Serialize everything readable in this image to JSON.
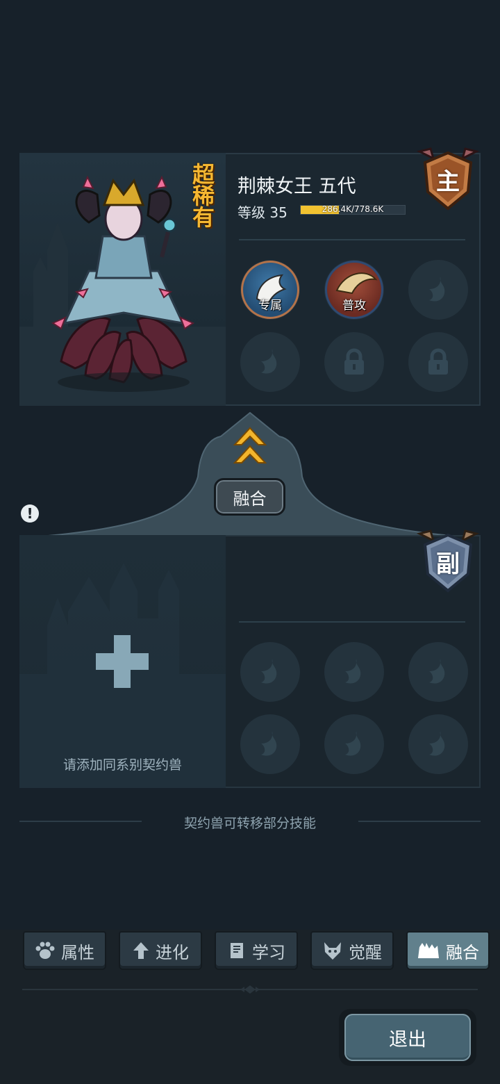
{
  "main_card": {
    "rarity": "超稀有",
    "name": "荆棘女王 五代",
    "level_label": "等级 35",
    "xp_text": "286.4K/778.6K",
    "xp_progress": 0.368,
    "badge": "主",
    "skills": [
      {
        "label": "专属",
        "state": "filled",
        "icon": "dragon-wing-icon"
      },
      {
        "label": "普攻",
        "state": "filled",
        "icon": "claw-slash-icon"
      },
      {
        "label": "",
        "state": "empty",
        "icon": "flame-icon"
      },
      {
        "label": "",
        "state": "empty",
        "icon": "flame-icon"
      },
      {
        "label": "",
        "state": "locked",
        "icon": "lock-icon"
      },
      {
        "label": "",
        "state": "locked",
        "icon": "lock-icon"
      }
    ]
  },
  "fusion": {
    "button_label": "融合",
    "warning": "!"
  },
  "sub_card": {
    "badge": "副",
    "add_hint": "请添加同系别契约兽",
    "skills_empty": 6
  },
  "note": "契约兽可转移部分技能",
  "tabs": [
    {
      "label": "属性",
      "icon": "paw-icon",
      "active": false
    },
    {
      "label": "进化",
      "icon": "up-arrow-icon",
      "active": false
    },
    {
      "label": "学习",
      "icon": "book-icon",
      "active": false
    },
    {
      "label": "觉醒",
      "icon": "wolf-icon",
      "active": false
    },
    {
      "label": "融合",
      "icon": "beasts-icon",
      "active": true
    }
  ],
  "exit_label": "退出",
  "colors": {
    "background": "#17212a",
    "rarity": "#f5b731",
    "xp_fill": "#f2c230",
    "active_tab": "#61808c",
    "exit_button": "#466472"
  }
}
